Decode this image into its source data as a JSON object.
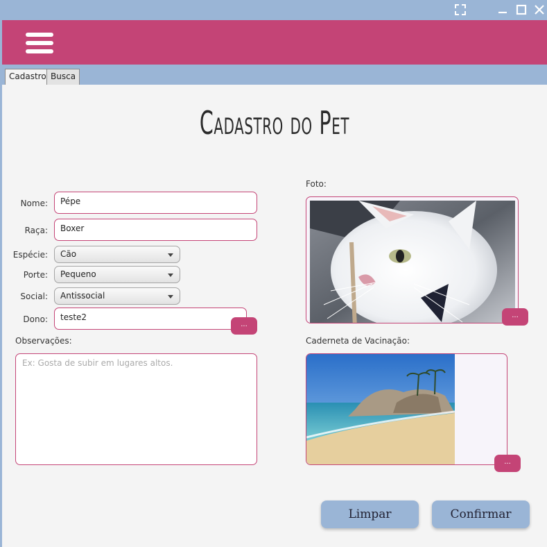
{
  "window": {
    "controls": [
      "fullscreen-icon",
      "minimize-icon",
      "maximize-icon",
      "close-icon"
    ]
  },
  "header": {
    "menu_icon": "hamburger-menu-icon",
    "color": "#c44476"
  },
  "tabs": [
    {
      "label": "Cadastro",
      "active": true
    },
    {
      "label": "Busca",
      "active": false
    }
  ],
  "form": {
    "title": "Cadastro do Pet",
    "nome": {
      "label": "Nome:",
      "value": "Pépe"
    },
    "raca": {
      "label": "Raça:",
      "value": "Boxer"
    },
    "especie": {
      "label": "Espécie:",
      "value": "Cão"
    },
    "porte": {
      "label": "Porte:",
      "value": "Pequeno"
    },
    "social": {
      "label": "Social:",
      "value": "Antissocial"
    },
    "dono": {
      "label": "Dono:",
      "value": "teste2",
      "button": "..."
    },
    "observacoes": {
      "label": "Observações:",
      "placeholder": "Ex: Gosta de subir em lugares altos."
    },
    "foto": {
      "label": "Foto:",
      "button": "..."
    },
    "caderneta": {
      "label": "Caderneta de Vacinação:",
      "button": "..."
    }
  },
  "actions": {
    "clear": "Limpar",
    "confirm": "Confirmar"
  },
  "colors": {
    "accent": "#c44476",
    "chrome": "#9ab5d6",
    "background": "#f4f4f4"
  }
}
